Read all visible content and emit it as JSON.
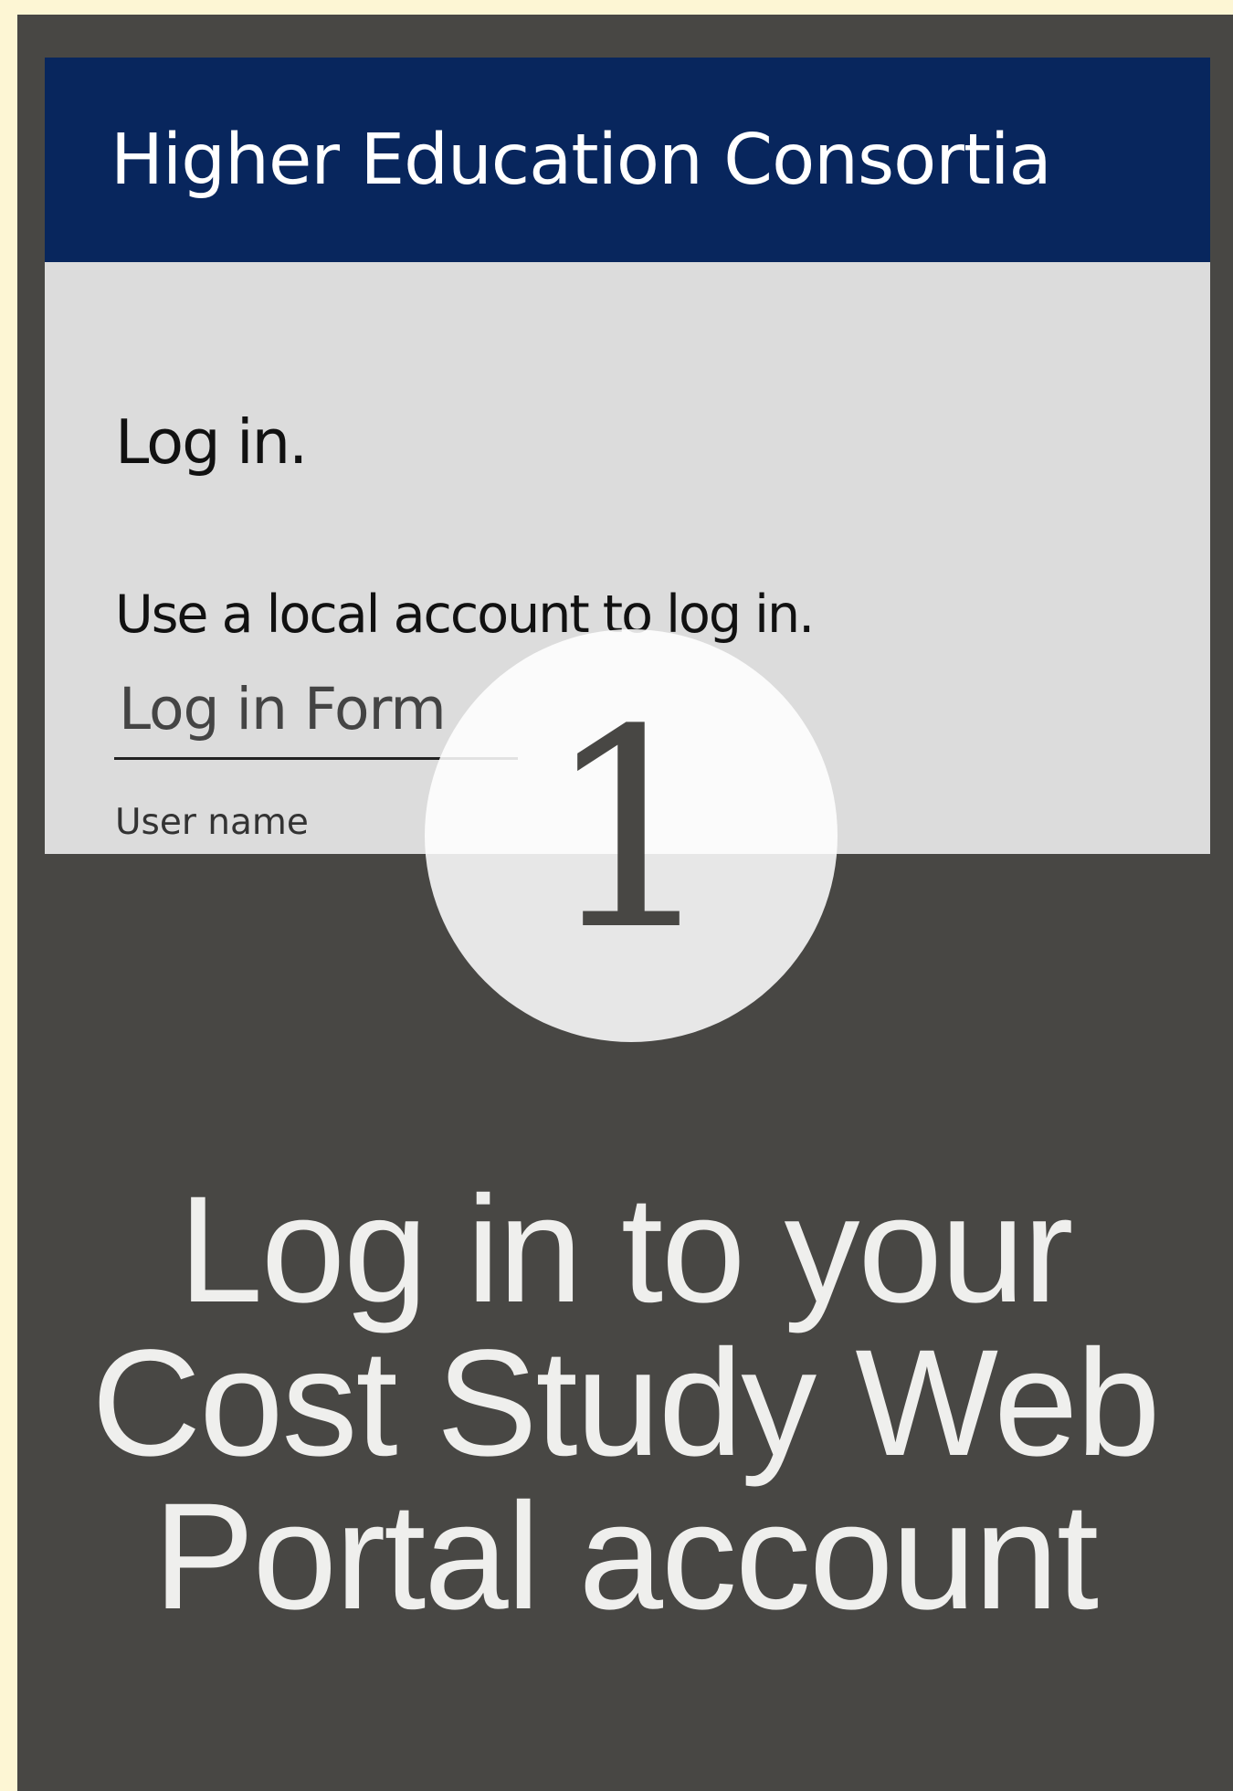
{
  "site": {
    "title": "Higher Education Consortia"
  },
  "login": {
    "heading": "Log in.",
    "subheading": "Use a local account to log in.",
    "form_legend": "Log in Form",
    "username_label": "User name"
  },
  "step": {
    "number": "1",
    "caption_lines": [
      "Log in to your",
      "Cost Study Web",
      "Portal account"
    ]
  },
  "colors": {
    "header_bg": "#08265d",
    "panel_bg": "#484744",
    "page_bg": "#fdf6d4",
    "form_bg": "#dcdcdc",
    "caption_text": "#efefed"
  }
}
